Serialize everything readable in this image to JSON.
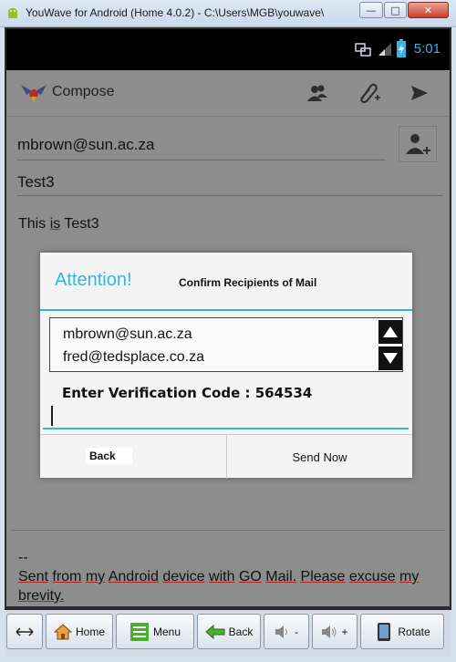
{
  "window": {
    "title": "YouWave for Android (Home 4.0.2) - C:\\Users\\MGB\\youwave\\",
    "minimize": "—",
    "maximize": "□",
    "close": "✕"
  },
  "statusbar": {
    "time": "5:01"
  },
  "compose": {
    "title": "Compose",
    "to": "mbrown@sun.ac.za",
    "subject": "Test3",
    "body_words": [
      "This",
      "is",
      "Test3"
    ]
  },
  "signature": {
    "dashes": "--",
    "words": [
      "Sent",
      "from",
      "my",
      "Android",
      "device",
      "with",
      "GO",
      "Mail.",
      "Please",
      "excuse",
      "my",
      "brevity."
    ]
  },
  "dialog": {
    "title": "Attention!",
    "subtitle": "Confirm Recipients of Mail",
    "recipients": [
      "mbrown@sun.ac.za",
      "fred@tedsplace.co.za"
    ],
    "code_label": "Enter Verification Code : ",
    "code": "564534",
    "code_value": "",
    "back_label": "Back",
    "send_label": "Send Now"
  },
  "bottombar": {
    "home": "Home",
    "menu": "Menu",
    "back": "Back",
    "vol_down": "-",
    "vol_up": "+",
    "rotate": "Rotate"
  },
  "colors": {
    "accent": "#33b5e5",
    "spell_underline": "#b22222"
  }
}
